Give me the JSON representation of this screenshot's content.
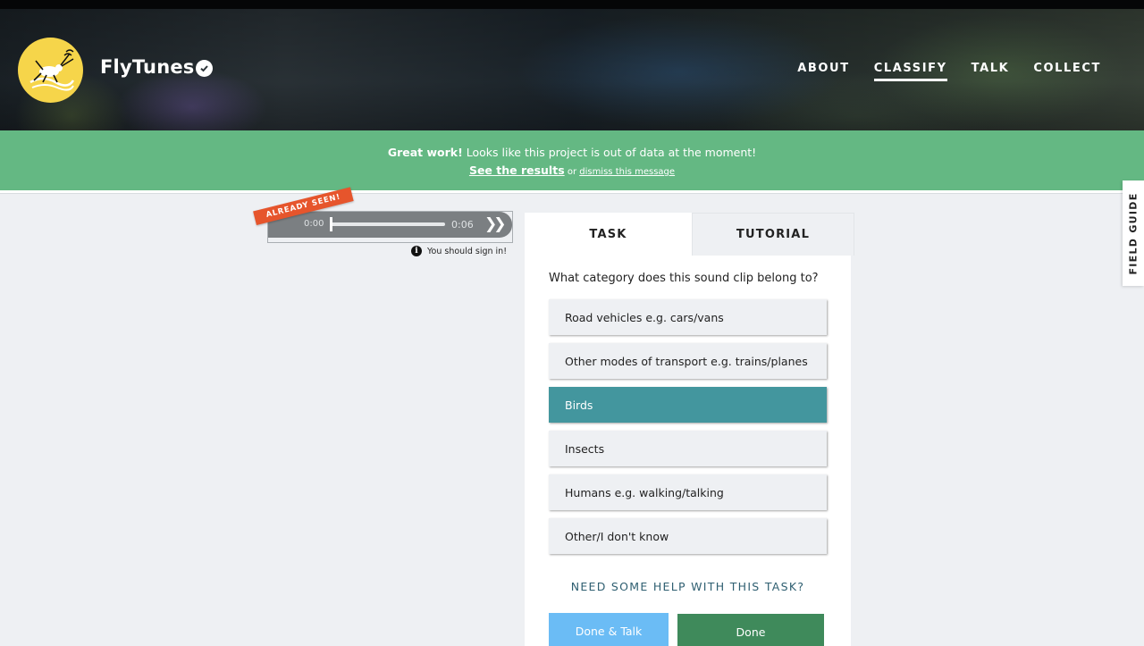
{
  "header": {
    "project_title": "FlyTunes",
    "nav": [
      {
        "label": "ABOUT",
        "active": false
      },
      {
        "label": "CLASSIFY",
        "active": true
      },
      {
        "label": "TALK",
        "active": false
      },
      {
        "label": "COLLECT",
        "active": false
      }
    ]
  },
  "banner": {
    "strong": "Great work!",
    "message": " Looks like this project is out of data at the moment!",
    "results_link": "See the results",
    "or_text": " or ",
    "dismiss_link": "dismiss this message",
    "color": "#64b883"
  },
  "player": {
    "time_current": "0:00",
    "time_total": "0:06",
    "progress": 0.0,
    "ribbon": "ALREADY SEEN!",
    "signin_note": "You should sign in!"
  },
  "task": {
    "tabs": [
      {
        "label": "TASK",
        "active": true
      },
      {
        "label": "TUTORIAL",
        "active": false
      }
    ],
    "question": "What category does this sound clip belong to?",
    "answers": [
      {
        "label": "Road vehicles e.g. cars/vans",
        "selected": false
      },
      {
        "label": "Other modes of transport e.g. trains/planes",
        "selected": false
      },
      {
        "label": "Birds",
        "selected": true
      },
      {
        "label": "Insects",
        "selected": false
      },
      {
        "label": "Humans e.g. walking/talking",
        "selected": false
      },
      {
        "label": "Other/I don't know",
        "selected": false
      }
    ],
    "help": "NEED SOME HELP WITH THIS TASK?",
    "done_talk": "Done & Talk",
    "done": "Done",
    "selected_color": "#43969e"
  },
  "field_guide": {
    "label": "FIELD GUIDE"
  }
}
